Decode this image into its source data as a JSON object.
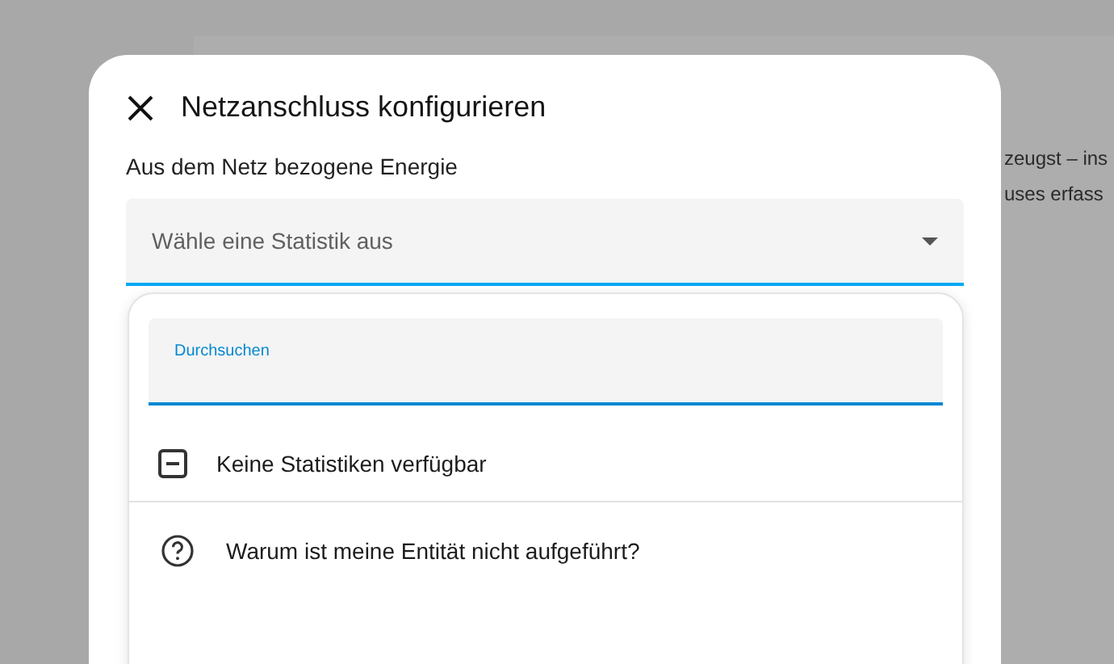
{
  "background": {
    "lines": [
      "zeugst – ins",
      "uses erfass"
    ]
  },
  "dialog": {
    "title": "Netzanschluss konfigurieren",
    "field_label": "Aus dem Netz bezogene Energie",
    "select": {
      "placeholder": "Wähle eine Statistik aus",
      "expanded": true
    },
    "menu": {
      "search": {
        "label": "Durchsuchen"
      },
      "items": [
        {
          "kind": "empty",
          "label": "Keine Statistiken verfügbar"
        },
        {
          "kind": "help",
          "label": "Warum ist meine Entität nicht aufgeführt?"
        }
      ]
    }
  }
}
